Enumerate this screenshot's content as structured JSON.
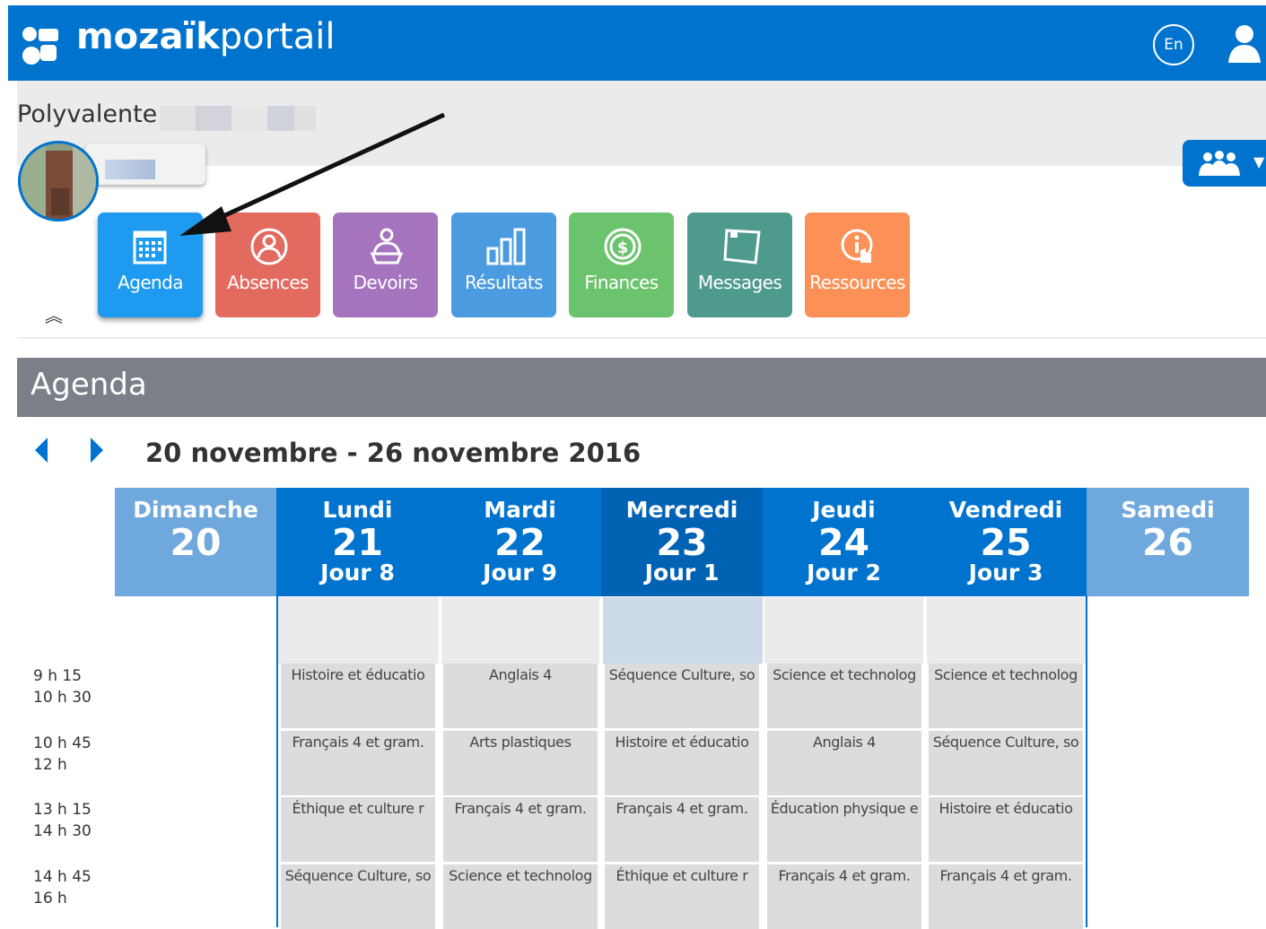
{
  "app": {
    "brand_bold": "mozaïk",
    "brand_light": "portail",
    "lang_button": "En",
    "school_name": "Polyvalente"
  },
  "colors": {
    "topbar": "#0073cf",
    "agenda_bar": "#7a7f88",
    "weekday_header": "#0073cf",
    "today_header": "#0062b3",
    "weekend_header": "#6fa8dc"
  },
  "tiles": [
    {
      "label": "Agenda",
      "icon": "calendar-icon",
      "color": "#1e9bf0",
      "active": true
    },
    {
      "label": "Absences",
      "icon": "person-circle-icon",
      "color": "#e36a5f"
    },
    {
      "label": "Devoirs",
      "icon": "student-desk-icon",
      "color": "#a674be"
    },
    {
      "label": "Résultats",
      "icon": "bar-chart-icon",
      "color": "#4a9be0"
    },
    {
      "label": "Finances",
      "icon": "dollar-coin-icon",
      "color": "#6cc36d"
    },
    {
      "label": "Messages",
      "icon": "note-icon",
      "color": "#4e9a8d"
    },
    {
      "label": "Ressources",
      "icon": "info-hand-icon",
      "color": "#fb9157"
    }
  ],
  "agenda": {
    "title": "Agenda",
    "range": "20 novembre  - 26 novembre 2016",
    "days": [
      {
        "name": "Dimanche",
        "date": "20",
        "jour": ""
      },
      {
        "name": "Lundi",
        "date": "21",
        "jour": "Jour 8"
      },
      {
        "name": "Mardi",
        "date": "22",
        "jour": "Jour 9"
      },
      {
        "name": "Mercredi",
        "date": "23",
        "jour": "Jour 1"
      },
      {
        "name": "Jeudi",
        "date": "24",
        "jour": "Jour 2"
      },
      {
        "name": "Vendredi",
        "date": "25",
        "jour": "Jour 3"
      },
      {
        "name": "Samedi",
        "date": "26",
        "jour": ""
      }
    ],
    "periods": [
      {
        "start": "9 h 15",
        "end": "10 h 30"
      },
      {
        "start": "10 h 45",
        "end": "12 h"
      },
      {
        "start": "13 h 15",
        "end": "14 h 30"
      },
      {
        "start": "14 h 45",
        "end": "16 h"
      }
    ],
    "courses": [
      [
        "Histoire et éducatio",
        "Anglais 4",
        "Séquence Culture, so",
        "Science et technolog",
        "Science et technolog"
      ],
      [
        "Français 4 et gram.",
        "Arts plastiques",
        "Histoire et éducatio",
        "Anglais 4",
        "Séquence Culture, so"
      ],
      [
        "Éthique et culture r",
        "Français 4 et gram.",
        "Français 4 et gram.",
        "Éducation physique e",
        "Histoire et éducatio"
      ],
      [
        "Séquence Culture, so",
        "Science et technolog",
        "Éthique et culture r",
        "Français 4 et gram.",
        "Français 4 et gram."
      ]
    ]
  }
}
